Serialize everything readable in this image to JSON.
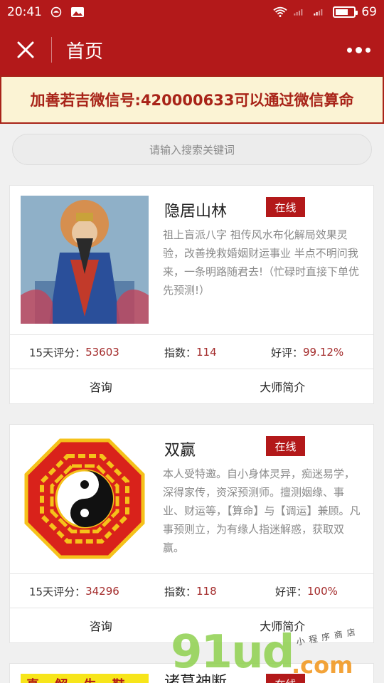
{
  "status_bar": {
    "time": "20:41",
    "battery": "69",
    "battery_level": 0.69
  },
  "header": {
    "title": "首页"
  },
  "banner": {
    "text": "加善若吉微信号:420000633可以通过微信算命"
  },
  "search": {
    "placeholder": "请输入搜索关键词"
  },
  "cards": [
    {
      "name": "隐居山林",
      "status": "在线",
      "description": "祖上盲派八字 祖传风水布化解局效果灵验，改善挽救婚姻财运事业 半点不明问我来，一条明路随君去!（忙碌时直接下单优先预测!）",
      "score_label": "15天评分：",
      "score": "53603",
      "index_label": "指数：",
      "index": "114",
      "rating_label": "好评：",
      "rating": "99.12%",
      "consult_label": "咨询",
      "intro_label": "大师简介"
    },
    {
      "name": "双赢",
      "status": "在线",
      "description": "本人受特邀。自小身体灵异，痴迷易学，深得家传，资深预测师。擅测姻缘、事业、财运等，【算命】与【调运】兼顾。凡事预则立，为有缘人指迷解惑，获取双赢。",
      "score_label": "15天评分：",
      "score": "34296",
      "index_label": "指数：",
      "index": "118",
      "rating_label": "好评：",
      "rating": "100%",
      "consult_label": "咨询",
      "intro_label": "大师简介"
    }
  ],
  "partial_card": {
    "name": "诸葛神断",
    "status": "在线",
    "strip_text": "真 解 生 鞋"
  },
  "watermark": {
    "brand": "91ud",
    "suffix": ".com",
    "tagline": "小程序商店"
  },
  "colors": {
    "primary": "#b3191a",
    "banner_bg": "#fbf3d4",
    "value_red": "#a32a2a"
  }
}
